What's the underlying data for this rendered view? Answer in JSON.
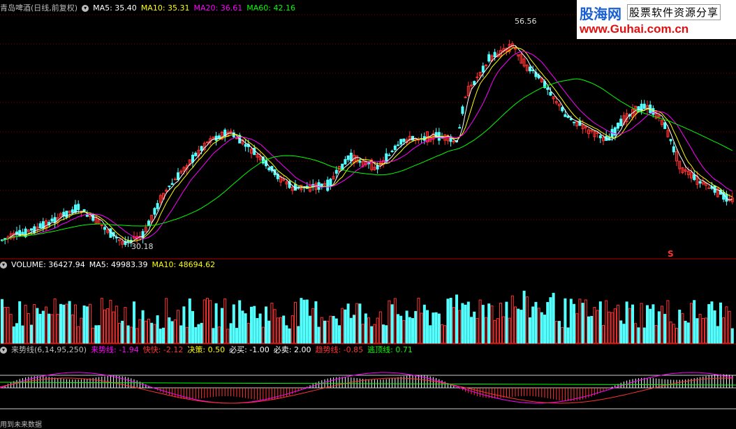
{
  "main_header": {
    "stock_name": "青岛啤酒(日线,前复权)",
    "ma5_label": "MA5: 35.40",
    "ma10_label": "MA10: 35.31",
    "ma20_label": "MA20: 36.61",
    "ma60_label": "MA60: 42.16"
  },
  "price_annotations": {
    "high": "56.56",
    "low": "30.18"
  },
  "marker": "S",
  "volume_header": {
    "volume_label": "VOLUME: 36427.94",
    "ma5_label": "MA5: 49983.39",
    "ma10_label": "MA10: 48694.62"
  },
  "indicator_header": {
    "name": "来势线(6,14,95,250)",
    "laishi_label": "来势线: -1.94",
    "kuaikuai_label": "快快: -2.12",
    "juece_label": "决策: 0.50",
    "bimai_label": "必买: -1.00",
    "bimai2_label": "必卖: 2.00",
    "qushi_label": "趋势线: -0.85",
    "taoding_label": "逃顶线: 0.71"
  },
  "logo": {
    "line1": "股海网",
    "line1b": "股票软件资源分享",
    "line2": "www.Guhai.com.cn"
  },
  "footer": "用到未来数据",
  "colors": {
    "up": "#ff3232",
    "down": "#54ffff",
    "ma5": "#ffffff",
    "ma10": "#ffff00",
    "ma20": "#ff00ff",
    "ma60": "#00ff00",
    "grid": "#8b0000",
    "divider": "#b00000"
  }
}
